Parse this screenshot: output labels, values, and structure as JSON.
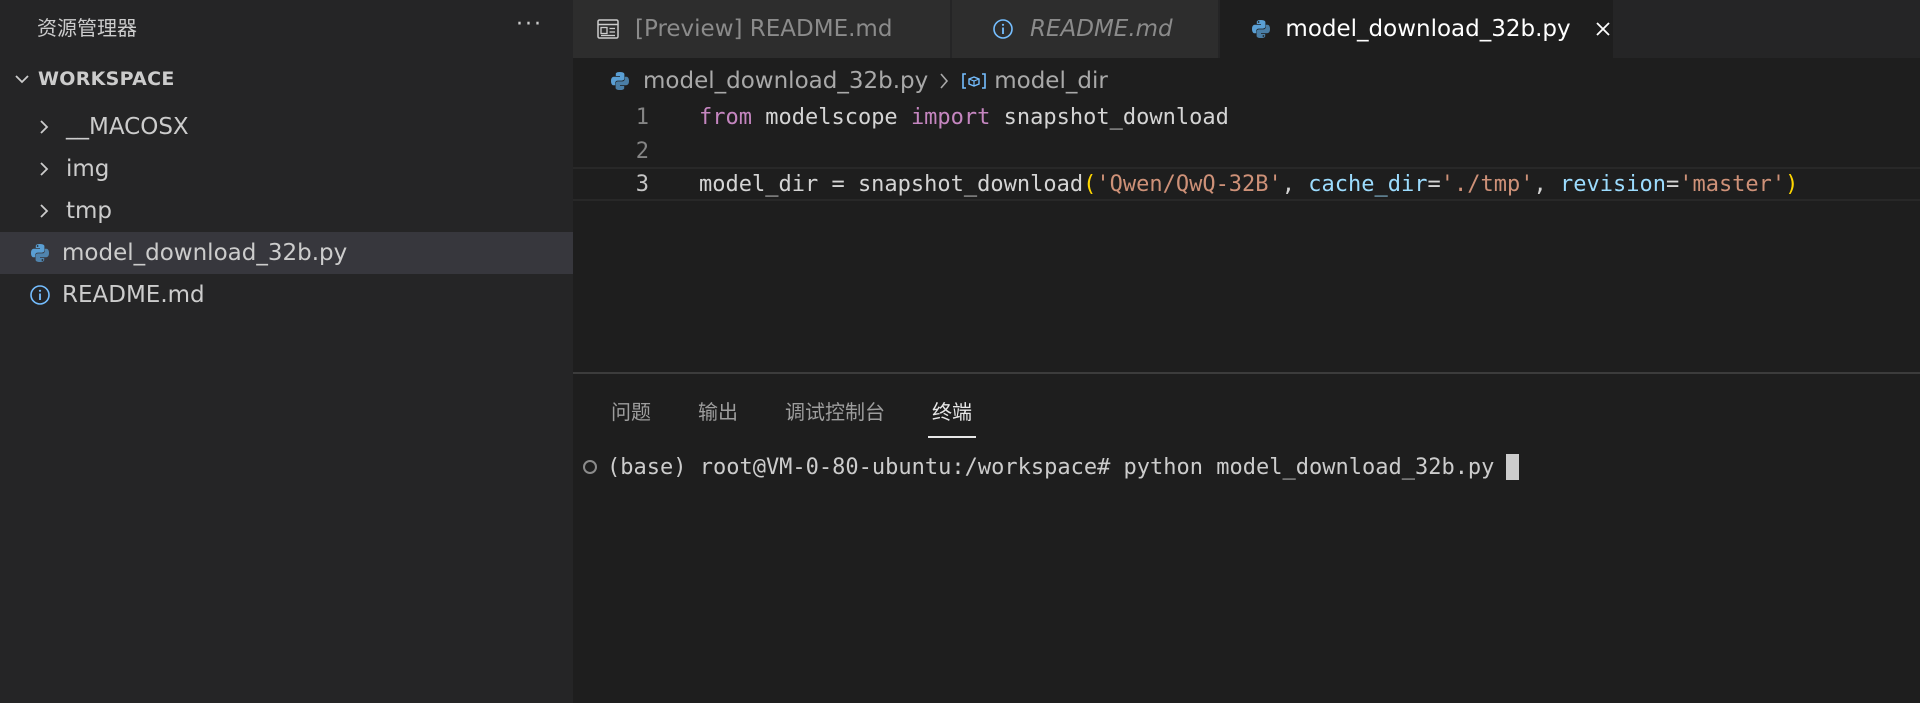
{
  "sidebar": {
    "title": "资源管理器",
    "more": "···",
    "section_label": "WORKSPACE",
    "items": [
      {
        "label": "__MACOSX",
        "type": "folder"
      },
      {
        "label": "img",
        "type": "folder"
      },
      {
        "label": "tmp",
        "type": "folder"
      },
      {
        "label": "model_download_32b.py",
        "type": "python",
        "selected": true
      },
      {
        "label": "README.md",
        "type": "info"
      }
    ]
  },
  "tabs": [
    {
      "label": "[Preview] README.md",
      "icon": "preview-icon"
    },
    {
      "label": "README.md",
      "icon": "info-icon",
      "italic": true
    },
    {
      "label": "model_download_32b.py",
      "icon": "python-icon",
      "active": true
    }
  ],
  "breadcrumb": {
    "file": "model_download_32b.py",
    "symbol": "model_dir"
  },
  "editor": {
    "line_numbers": [
      "1",
      "2",
      "3"
    ],
    "line1": {
      "kw1": "from",
      "mod": " modelscope ",
      "kw2": "import",
      "name": " snapshot_download"
    },
    "line3": {
      "var": "model_dir = snapshot_download",
      "open": "(",
      "arg1": "'Qwen/QwQ-32B'",
      "comma1": ", ",
      "p1": "cache_dir",
      "eq1": "=",
      "arg2": "'./tmp'",
      "comma2": ", ",
      "p2": "revision",
      "eq2": "=",
      "arg3": "'master'",
      "close": ")"
    }
  },
  "panel": {
    "tabs": [
      "问题",
      "输出",
      "调试控制台",
      "终端"
    ],
    "terminal_line": "(base) root@VM-0-80-ubuntu:/workspace# python model_download_32b.py"
  },
  "colors": {
    "python": "#5a9fd4",
    "info": "#75beff",
    "keyword": "#c586c0",
    "string": "#ce9178",
    "param": "#9cdcfe",
    "paren": "#ffd700"
  }
}
